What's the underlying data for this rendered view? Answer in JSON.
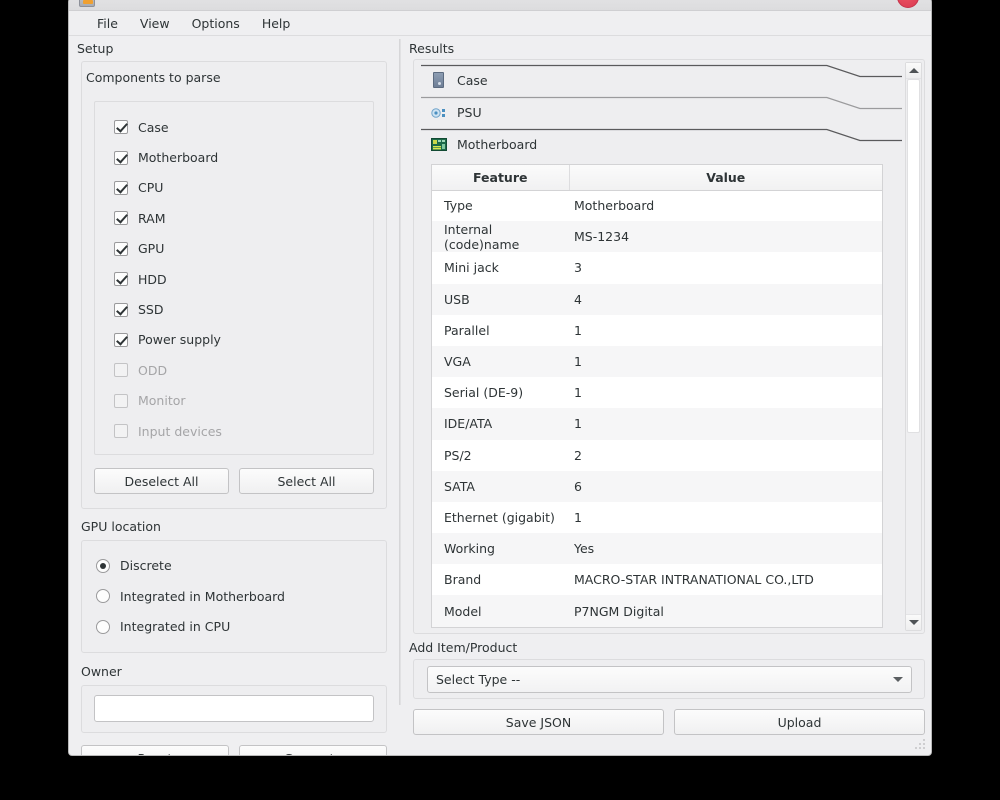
{
  "window": {
    "title_icon": "app-icon",
    "close_button": "close-button"
  },
  "menubar": {
    "items": [
      {
        "label": "File"
      },
      {
        "label": "View"
      },
      {
        "label": "Options"
      },
      {
        "label": "Help"
      }
    ]
  },
  "panes": {
    "left_title": "Setup",
    "right_title": "Results"
  },
  "components": {
    "group_label": "Components to parse",
    "items": [
      {
        "label": "Case",
        "checked": true,
        "enabled": true
      },
      {
        "label": "Motherboard",
        "checked": true,
        "enabled": true
      },
      {
        "label": "CPU",
        "checked": true,
        "enabled": true
      },
      {
        "label": "RAM",
        "checked": true,
        "enabled": true
      },
      {
        "label": "GPU",
        "checked": true,
        "enabled": true
      },
      {
        "label": "HDD",
        "checked": true,
        "enabled": true
      },
      {
        "label": "SSD",
        "checked": true,
        "enabled": true
      },
      {
        "label": "Power supply",
        "checked": true,
        "enabled": true
      },
      {
        "label": "ODD",
        "checked": false,
        "enabled": false
      },
      {
        "label": "Monitor",
        "checked": false,
        "enabled": false
      },
      {
        "label": "Input devices",
        "checked": false,
        "enabled": false
      }
    ],
    "deselect_all_label": "Deselect All",
    "select_all_label": "Select All"
  },
  "gpu_location": {
    "group_label": "GPU location",
    "options": [
      {
        "label": "Discrete",
        "selected": true
      },
      {
        "label": "Integrated in Motherboard",
        "selected": false
      },
      {
        "label": "Integrated in CPU",
        "selected": false
      }
    ]
  },
  "owner": {
    "group_label": "Owner",
    "value": "",
    "placeholder": ""
  },
  "left_actions": {
    "reset_label": "Reset",
    "generate_label": "Generate"
  },
  "results": {
    "sections": [
      {
        "label": "Case",
        "icon": "computer-case-icon",
        "expanded": false
      },
      {
        "label": "PSU",
        "icon": "psu-fan-icon",
        "expanded": false
      },
      {
        "label": "Motherboard",
        "icon": "motherboard-icon",
        "expanded": true
      }
    ],
    "table": {
      "headers": [
        "Feature",
        "Value"
      ],
      "rows": [
        [
          "Type",
          "Motherboard"
        ],
        [
          "Internal (code)name",
          "MS-1234"
        ],
        [
          "Mini jack",
          "3"
        ],
        [
          "USB",
          "4"
        ],
        [
          "Parallel",
          "1"
        ],
        [
          "VGA",
          "1"
        ],
        [
          "Serial (DE-9)",
          "1"
        ],
        [
          "IDE/ATA",
          "1"
        ],
        [
          "PS/2",
          "2"
        ],
        [
          "SATA",
          "6"
        ],
        [
          "Ethernet (gigabit)",
          "1"
        ],
        [
          "Working",
          "Yes"
        ],
        [
          "Brand",
          "MACRO-STAR INTRANATIONAL CO.,LTD"
        ],
        [
          "Model",
          "P7NGM Digital"
        ]
      ]
    },
    "scrollbar": {
      "up_arrow": "scroll-up-arrow",
      "down_arrow": "scroll-down-arrow"
    }
  },
  "add_item": {
    "group_label": "Add Item/Product",
    "select_value": "Select Type --",
    "save_json_label": "Save JSON",
    "upload_label": "Upload"
  },
  "colors": {
    "window_bg": "#efeff1",
    "panel_bg": "#eeeef0",
    "border": "#dcdcde",
    "text": "#2e3436",
    "text_disabled": "#a5a5a7",
    "close_red": "#d93a50",
    "row_alt": "#f6f6f7",
    "mobo_green": "#1d6b4a",
    "psu_blue": "#4a8fc0"
  }
}
